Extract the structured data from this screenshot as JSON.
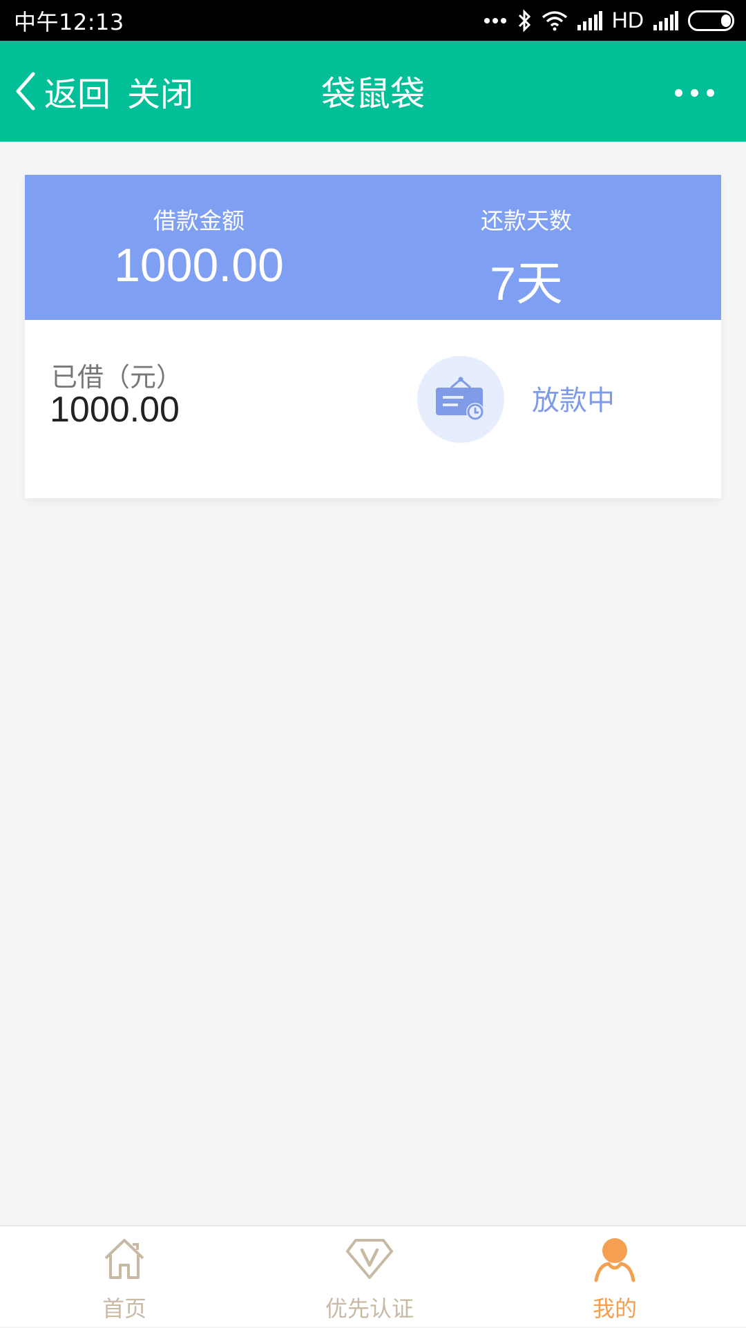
{
  "status_bar": {
    "time": "中午12:13",
    "network_label": "HD",
    "icons": [
      "more-dots-icon",
      "bluetooth-icon",
      "wifi-icon",
      "signal-icon",
      "signal-icon",
      "battery-icon"
    ]
  },
  "navbar": {
    "back_label": "返回",
    "close_label": "关闭",
    "title": "袋鼠袋",
    "more_icon": "more-horizontal-icon",
    "background": "#02bf98"
  },
  "loan_card": {
    "header_background": "#7fa0f2",
    "amount": {
      "label": "借款金额",
      "value": "1000.00"
    },
    "days": {
      "label": "还款天数",
      "value": "7天"
    },
    "borrowed": {
      "label": "已借（元）",
      "value": "1000.00"
    },
    "status": {
      "icon": "clock-notice-icon",
      "text": "放款中",
      "color": "#7f9be8"
    }
  },
  "tabbar": {
    "tabs": [
      {
        "label": "首页",
        "icon": "home-icon",
        "active": false
      },
      {
        "label": "优先认证",
        "icon": "v-badge-icon",
        "active": false
      },
      {
        "label": "我的",
        "icon": "user-icon",
        "active": true
      }
    ],
    "active_color": "#f5a050",
    "inactive_color": "#c8b9a5"
  }
}
